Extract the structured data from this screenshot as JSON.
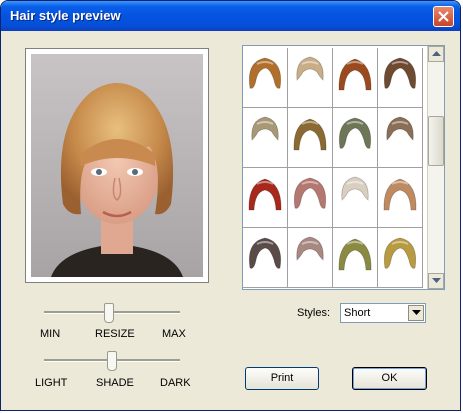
{
  "window": {
    "title": "Hair style preview"
  },
  "sliders": {
    "resize": {
      "min_label": "MIN",
      "name_label": "RESIZE",
      "max_label": "MAX",
      "value": 0.48
    },
    "shade": {
      "min_label": "LIGHT",
      "name_label": "SHADE",
      "max_label": "DARK",
      "value": 0.5
    }
  },
  "styles": {
    "label": "Styles:",
    "selected": "Short"
  },
  "buttons": {
    "print": "Print",
    "ok": "OK"
  },
  "gallery": {
    "rows": 4,
    "cols": 4,
    "colors": [
      "#b0702c",
      "#c8ad86",
      "#9a4a1e",
      "#6e4a30",
      "#a89876",
      "#8a6a32",
      "#6e7658",
      "#8a6e56",
      "#a8281c",
      "#b47870",
      "#d8cfc0",
      "#c08a60",
      "#5a4a48",
      "#a88880",
      "#8a8a40",
      "#b89a40"
    ]
  }
}
